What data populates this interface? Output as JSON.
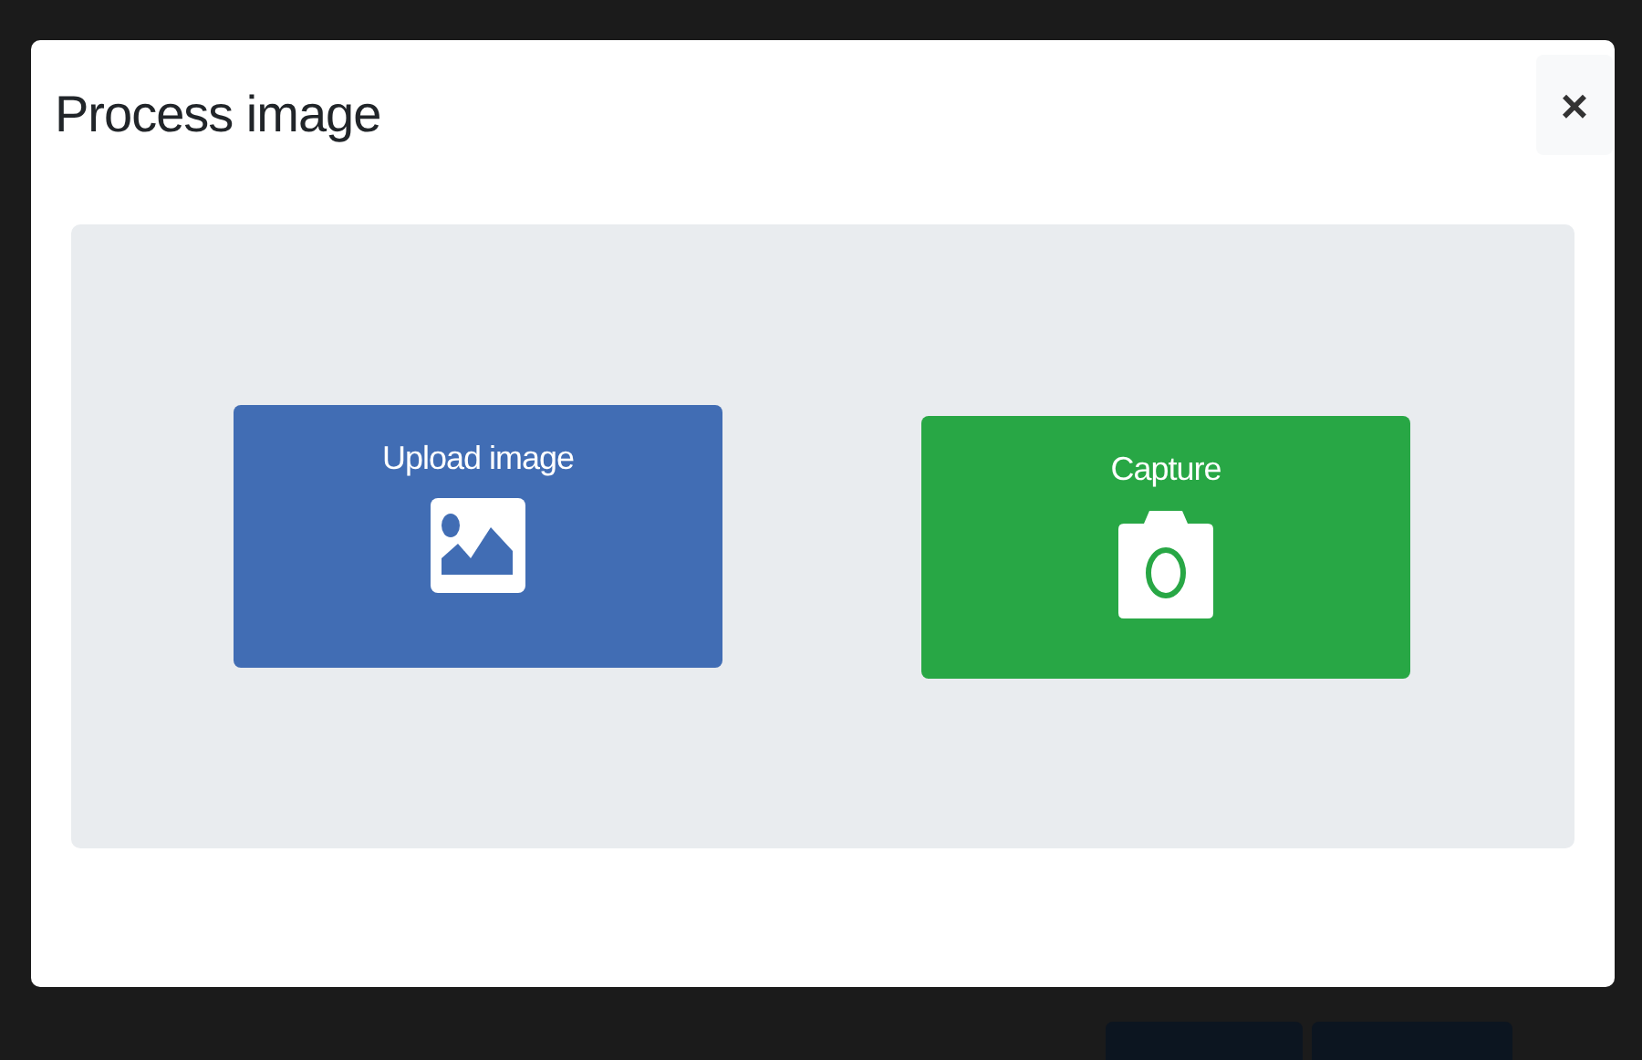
{
  "dialog": {
    "title": "Process image",
    "close": "×"
  },
  "options": [
    {
      "kind": "upload",
      "label": "Upload image",
      "color": "#416db4"
    },
    {
      "kind": "capture",
      "label": "Capture",
      "color": "#28a745"
    }
  ]
}
